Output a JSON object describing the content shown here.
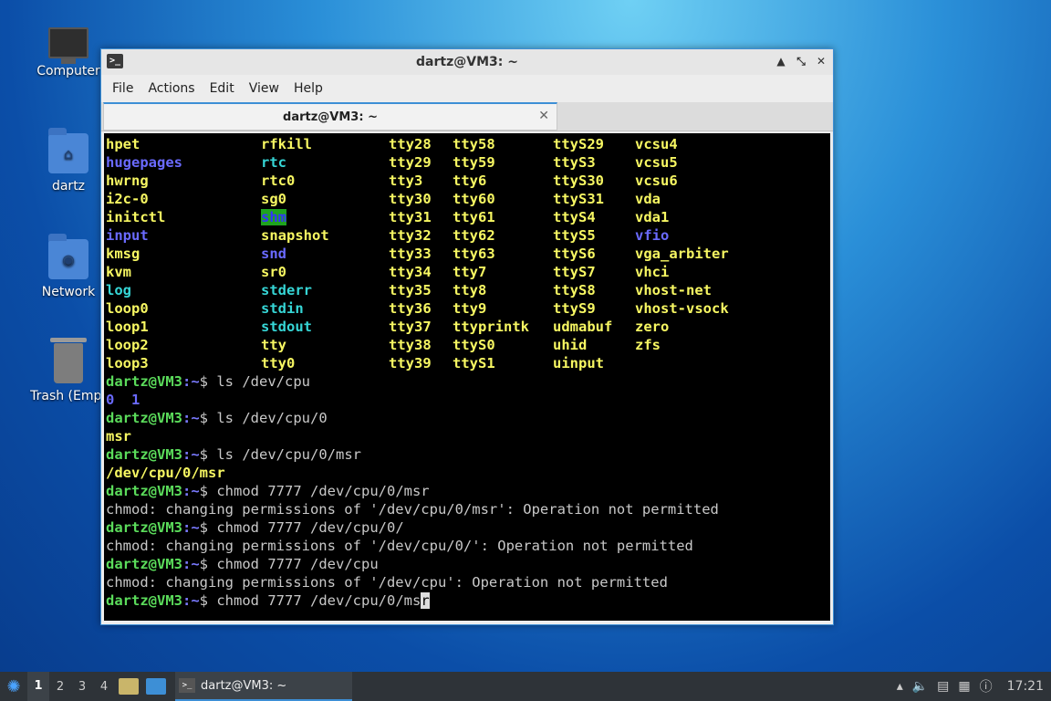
{
  "desktop": {
    "icons": [
      {
        "label": "Computer"
      },
      {
        "label": "dartz"
      },
      {
        "label": "Network"
      },
      {
        "label": "Trash (Empt"
      }
    ]
  },
  "window": {
    "title": "dartz@VM3: ~",
    "controls": {
      "min": "▲",
      "max": "⤡",
      "close": "✕"
    },
    "menu": [
      "File",
      "Actions",
      "Edit",
      "View",
      "Help"
    ],
    "tab": {
      "title": "dartz@VM3: ~",
      "close": "✕"
    }
  },
  "terminal": {
    "listing_rows": [
      [
        {
          "t": "hpet",
          "c": "yellow"
        },
        {
          "t": "rfkill",
          "c": "yellow"
        },
        {
          "t": "tty28",
          "c": "yellow"
        },
        {
          "t": "tty58",
          "c": "yellow"
        },
        {
          "t": "ttyS29",
          "c": "yellow"
        },
        {
          "t": "vcsu4",
          "c": "yellow"
        }
      ],
      [
        {
          "t": "hugepages",
          "c": "blue"
        },
        {
          "t": "rtc",
          "c": "cyan"
        },
        {
          "t": "tty29",
          "c": "yellow"
        },
        {
          "t": "tty59",
          "c": "yellow"
        },
        {
          "t": "ttyS3",
          "c": "yellow"
        },
        {
          "t": "vcsu5",
          "c": "yellow"
        }
      ],
      [
        {
          "t": "hwrng",
          "c": "yellow"
        },
        {
          "t": "rtc0",
          "c": "yellow"
        },
        {
          "t": "tty3",
          "c": "yellow"
        },
        {
          "t": "tty6",
          "c": "yellow"
        },
        {
          "t": "ttyS30",
          "c": "yellow"
        },
        {
          "t": "vcsu6",
          "c": "yellow"
        }
      ],
      [
        {
          "t": "i2c-0",
          "c": "yellow"
        },
        {
          "t": "sg0",
          "c": "yellow"
        },
        {
          "t": "tty30",
          "c": "yellow"
        },
        {
          "t": "tty60",
          "c": "yellow"
        },
        {
          "t": "ttyS31",
          "c": "yellow"
        },
        {
          "t": "vda",
          "c": "yellow"
        }
      ],
      [
        {
          "t": "initctl",
          "c": "yellow"
        },
        {
          "t": "shm",
          "c": "green-bg"
        },
        {
          "t": "tty31",
          "c": "yellow"
        },
        {
          "t": "tty61",
          "c": "yellow"
        },
        {
          "t": "ttyS4",
          "c": "yellow"
        },
        {
          "t": "vda1",
          "c": "yellow"
        }
      ],
      [
        {
          "t": "input",
          "c": "blue"
        },
        {
          "t": "snapshot",
          "c": "yellow"
        },
        {
          "t": "tty32",
          "c": "yellow"
        },
        {
          "t": "tty62",
          "c": "yellow"
        },
        {
          "t": "ttyS5",
          "c": "yellow"
        },
        {
          "t": "vfio",
          "c": "blue"
        }
      ],
      [
        {
          "t": "kmsg",
          "c": "yellow"
        },
        {
          "t": "snd",
          "c": "blue"
        },
        {
          "t": "tty33",
          "c": "yellow"
        },
        {
          "t": "tty63",
          "c": "yellow"
        },
        {
          "t": "ttyS6",
          "c": "yellow"
        },
        {
          "t": "vga_arbiter",
          "c": "yellow"
        }
      ],
      [
        {
          "t": "kvm",
          "c": "yellow"
        },
        {
          "t": "sr0",
          "c": "yellow"
        },
        {
          "t": "tty34",
          "c": "yellow"
        },
        {
          "t": "tty7",
          "c": "yellow"
        },
        {
          "t": "ttyS7",
          "c": "yellow"
        },
        {
          "t": "vhci",
          "c": "yellow"
        }
      ],
      [
        {
          "t": "log",
          "c": "cyan"
        },
        {
          "t": "stderr",
          "c": "cyan"
        },
        {
          "t": "tty35",
          "c": "yellow"
        },
        {
          "t": "tty8",
          "c": "yellow"
        },
        {
          "t": "ttyS8",
          "c": "yellow"
        },
        {
          "t": "vhost-net",
          "c": "yellow"
        }
      ],
      [
        {
          "t": "loop0",
          "c": "yellow"
        },
        {
          "t": "stdin",
          "c": "cyan"
        },
        {
          "t": "tty36",
          "c": "yellow"
        },
        {
          "t": "tty9",
          "c": "yellow"
        },
        {
          "t": "ttyS9",
          "c": "yellow"
        },
        {
          "t": "vhost-vsock",
          "c": "yellow"
        }
      ],
      [
        {
          "t": "loop1",
          "c": "yellow"
        },
        {
          "t": "stdout",
          "c": "cyan"
        },
        {
          "t": "tty37",
          "c": "yellow"
        },
        {
          "t": "ttyprintk",
          "c": "yellow"
        },
        {
          "t": "udmabuf",
          "c": "yellow"
        },
        {
          "t": "zero",
          "c": "yellow"
        }
      ],
      [
        {
          "t": "loop2",
          "c": "yellow"
        },
        {
          "t": "tty",
          "c": "yellow"
        },
        {
          "t": "tty38",
          "c": "yellow"
        },
        {
          "t": "ttyS0",
          "c": "yellow"
        },
        {
          "t": "uhid",
          "c": "yellow"
        },
        {
          "t": "zfs",
          "c": "yellow"
        }
      ],
      [
        {
          "t": "loop3",
          "c": "yellow"
        },
        {
          "t": "tty0",
          "c": "yellow"
        },
        {
          "t": "tty39",
          "c": "yellow"
        },
        {
          "t": "ttyS1",
          "c": "yellow"
        },
        {
          "t": "uinput",
          "c": "yellow"
        },
        {
          "t": "",
          "c": "yellow"
        }
      ]
    ],
    "prompt_user": "dartz@VM3",
    "prompt_path": ":~",
    "prompt_sign": "$",
    "lines": [
      {
        "type": "cmd",
        "text": " ls /dev/cpu"
      },
      {
        "type": "out",
        "parts": [
          {
            "t": "0",
            "c": "blue"
          },
          {
            "t": "  ",
            "c": "out"
          },
          {
            "t": "1",
            "c": "blue"
          }
        ]
      },
      {
        "type": "cmd",
        "text": " ls /dev/cpu/0"
      },
      {
        "type": "out",
        "parts": [
          {
            "t": "msr",
            "c": "yellow"
          }
        ]
      },
      {
        "type": "cmd",
        "text": " ls /dev/cpu/0/msr"
      },
      {
        "type": "out",
        "parts": [
          {
            "t": "/dev/cpu/0/msr",
            "c": "yellow"
          }
        ]
      },
      {
        "type": "cmd",
        "text": " chmod 7777 /dev/cpu/0/msr"
      },
      {
        "type": "out",
        "parts": [
          {
            "t": "chmod: changing permissions of '/dev/cpu/0/msr': Operation not permitted",
            "c": "out"
          }
        ]
      },
      {
        "type": "cmd",
        "text": " chmod 7777 /dev/cpu/0/"
      },
      {
        "type": "out",
        "parts": [
          {
            "t": "chmod: changing permissions of '/dev/cpu/0/': Operation not permitted",
            "c": "out"
          }
        ]
      },
      {
        "type": "cmd",
        "text": " chmod 7777 /dev/cpu"
      },
      {
        "type": "out",
        "parts": [
          {
            "t": "chmod: changing permissions of '/dev/cpu': Operation not permitted",
            "c": "out"
          }
        ]
      }
    ],
    "current_input": " chmod 7777 /dev/cpu/0/ms",
    "cursor_char": "r"
  },
  "taskbar": {
    "workspaces": [
      "1",
      "2",
      "3",
      "4"
    ],
    "active_workspace": "1",
    "task_title": "dartz@VM3: ~",
    "clock": "17:21"
  }
}
